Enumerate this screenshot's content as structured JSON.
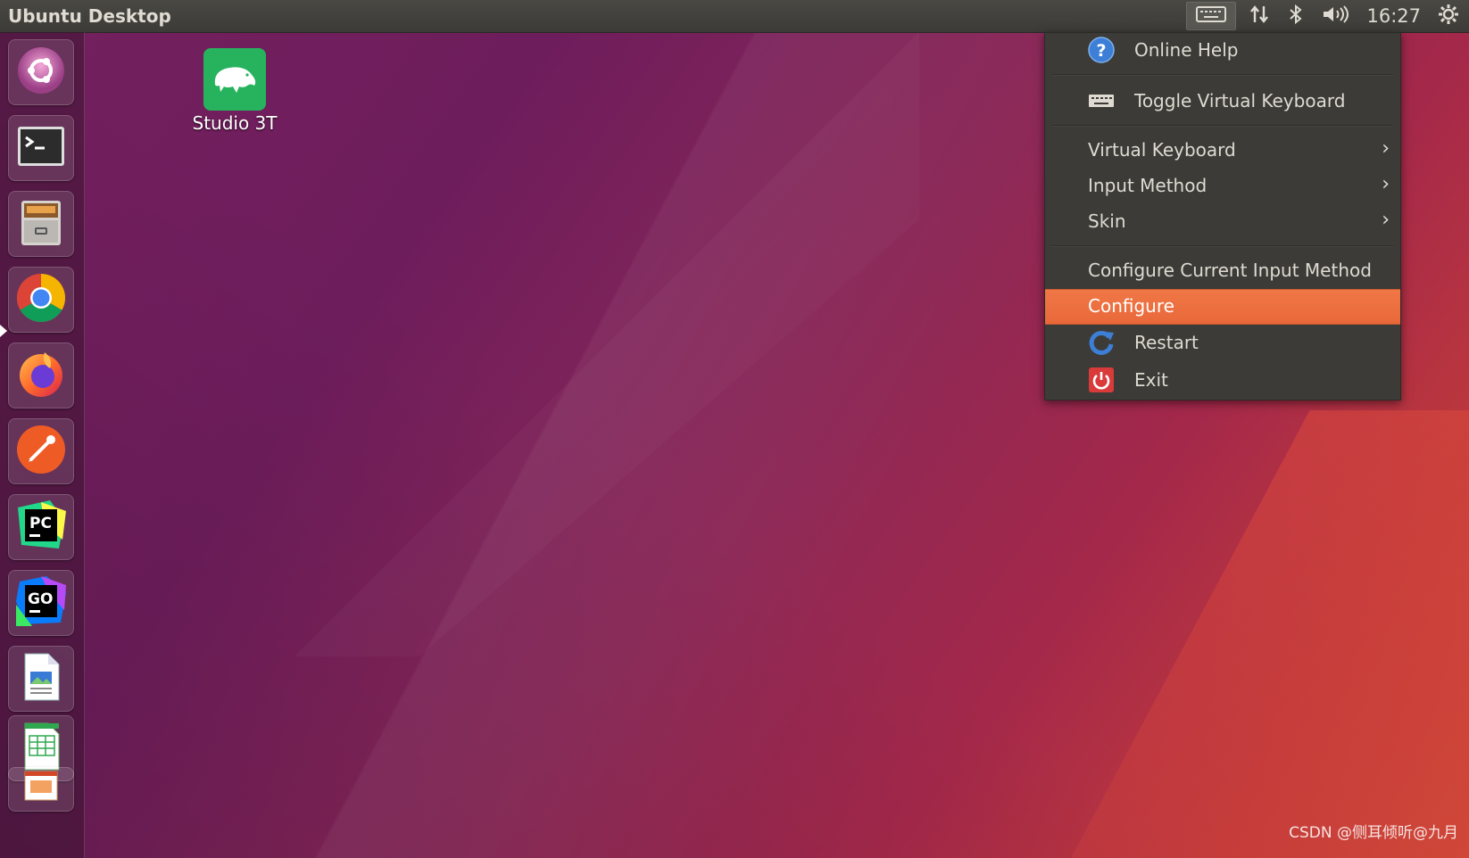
{
  "top_panel": {
    "title": "Ubuntu Desktop",
    "clock": "16:27",
    "indicators": [
      "keyboard-icon",
      "network-icon",
      "bluetooth-icon",
      "volume-icon",
      "gear-icon"
    ]
  },
  "launcher": {
    "apps": [
      "ubuntu-software",
      "terminal",
      "files",
      "chrome",
      "firefox",
      "postman",
      "pycharm",
      "goland",
      "libreoffice-writer",
      "libreoffice-calc",
      "libreoffice-impress"
    ],
    "active_app": "chrome"
  },
  "desktop": {
    "icons": [
      {
        "label": "Studio 3T"
      }
    ]
  },
  "menu": {
    "online_help": "Online Help",
    "toggle_keyboard": "Toggle Virtual Keyboard",
    "virtual_keyboard": "Virtual Keyboard",
    "input_method": "Input Method",
    "skin": "Skin",
    "configure_current": "Configure Current Input Method",
    "configure": "Configure",
    "restart": "Restart",
    "exit": "Exit",
    "submenu_arrow": "›",
    "highlighted": "configure"
  },
  "watermark": "CSDN @侧耳倾听@九月",
  "colors": {
    "panel": "#3c3b37",
    "highlight": "#e9683a",
    "studio3t": "#27b35e"
  }
}
